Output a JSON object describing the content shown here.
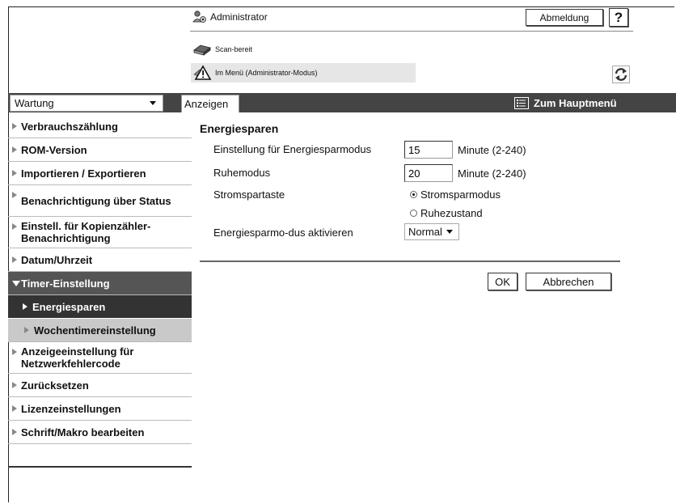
{
  "header": {
    "user_label": "Administrator",
    "logout_label": "Abmeldung",
    "help_label": "?",
    "device_status": "Scan-bereit",
    "menu_status": "Im Menü (Administrator-Modus)"
  },
  "toolbar": {
    "mode_select_value": "Wartung",
    "display_tab": "Anzeigen",
    "main_menu": "Zum Hauptmenü"
  },
  "sidebar": {
    "items": [
      {
        "label": "Verbrauchszählung"
      },
      {
        "label": "ROM-Version"
      },
      {
        "label": "Importieren / Exportieren"
      },
      {
        "label": "Benachrichtigung über Status"
      },
      {
        "label": "Einstell. für Kopienzähler-Benachrichtigung"
      },
      {
        "label": "Datum/Uhrzeit"
      },
      {
        "label": "Timer-Einstellung"
      },
      {
        "label": "Energiesparen"
      },
      {
        "label": "Wochentimereinstellung"
      },
      {
        "label": "Anzeigeeinstellung für Netzwerkfehlercode"
      },
      {
        "label": "Zurücksetzen"
      },
      {
        "label": "Lizenzeinstellungen"
      },
      {
        "label": "Schrift/Makro bearbeiten"
      }
    ]
  },
  "main": {
    "title": "Energiesparen",
    "energy_mode_label": "Einstellung für Energiesparmodus",
    "energy_mode_value": "15",
    "energy_mode_unit": "Minute (2-240)",
    "sleep_label": "Ruhemodus",
    "sleep_value": "20",
    "sleep_unit": "Minute (2-240)",
    "power_key_label": "Stromspartaste",
    "power_key_option_1": "Stromsparmodus",
    "power_key_option_2": "Ruhezustand",
    "power_key_selected": "Stromsparmodus",
    "activate_label": "Energiesparmo-dus aktivieren",
    "activate_value": "Normal",
    "ok_label": "OK",
    "cancel_label": "Abbrechen"
  }
}
